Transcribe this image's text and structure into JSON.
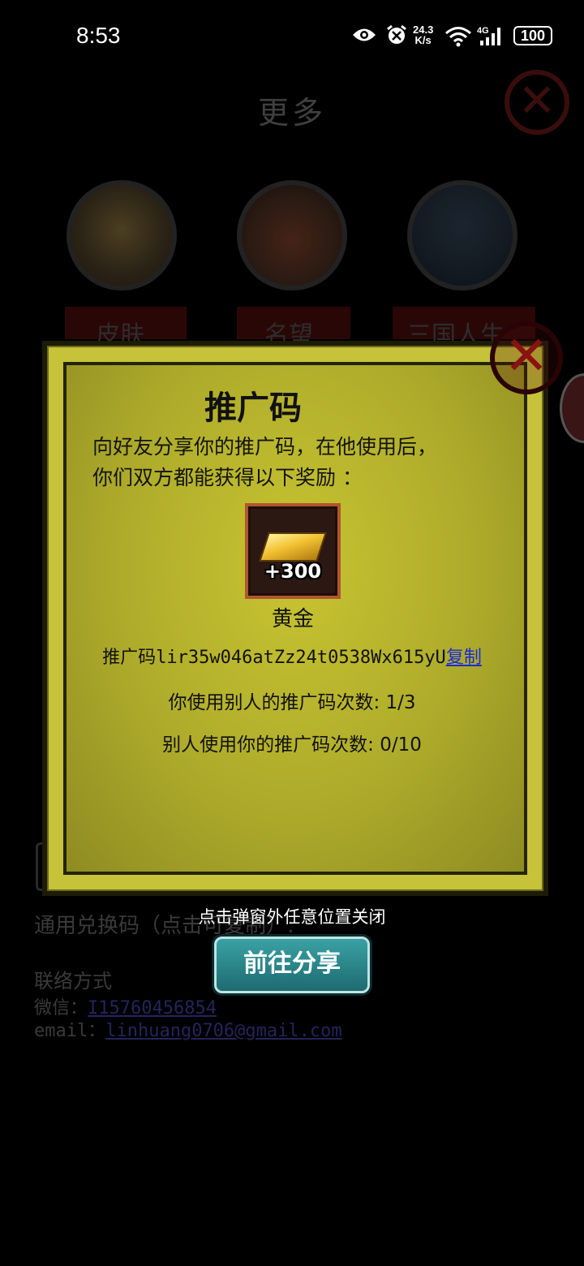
{
  "status_bar": {
    "time": "8:53",
    "net_speed_value": "24.3",
    "net_speed_unit": "K/s",
    "network": "4G",
    "battery": "100",
    "icons": [
      "eye-icon",
      "alarm-icon",
      "wifi-icon",
      "signal-icon"
    ]
  },
  "background": {
    "title": "更多",
    "menu": [
      {
        "label": "皮肤"
      },
      {
        "label": "名望"
      },
      {
        "label": "三国人生"
      }
    ],
    "redeem_label": "通用兑换码（点击可复制）:",
    "contact": {
      "heading": "联络方式",
      "wechat_label": "微信：",
      "wechat_value": "I15760456854",
      "email_label": "email：",
      "email_value": "linhuang0706@gmail.com"
    }
  },
  "modal": {
    "title": "推广码",
    "description_line1": "向好友分享你的推广码，在他使用后，",
    "description_line2": "你们双方都能获得以下奖励 ：",
    "reward": {
      "amount": "+300",
      "name": "黄金",
      "icon": "gold-bar-icon"
    },
    "promo_label": "推广码",
    "promo_code": "lir35w046atZz24t0538Wx615yU",
    "copy_label": "复制",
    "used_others": "你使用别人的推广码次数: 1/3",
    "used_mine": "别人使用你的推广码次数: 0/10"
  },
  "dismiss_hint": "点击弹窗外任意位置关闭",
  "share_button": "前往分享",
  "colors": {
    "modal_bg": "#c6c23a",
    "link": "#1c2adc",
    "share_button": "#2a8a8e",
    "close_red": "#8a1212"
  }
}
